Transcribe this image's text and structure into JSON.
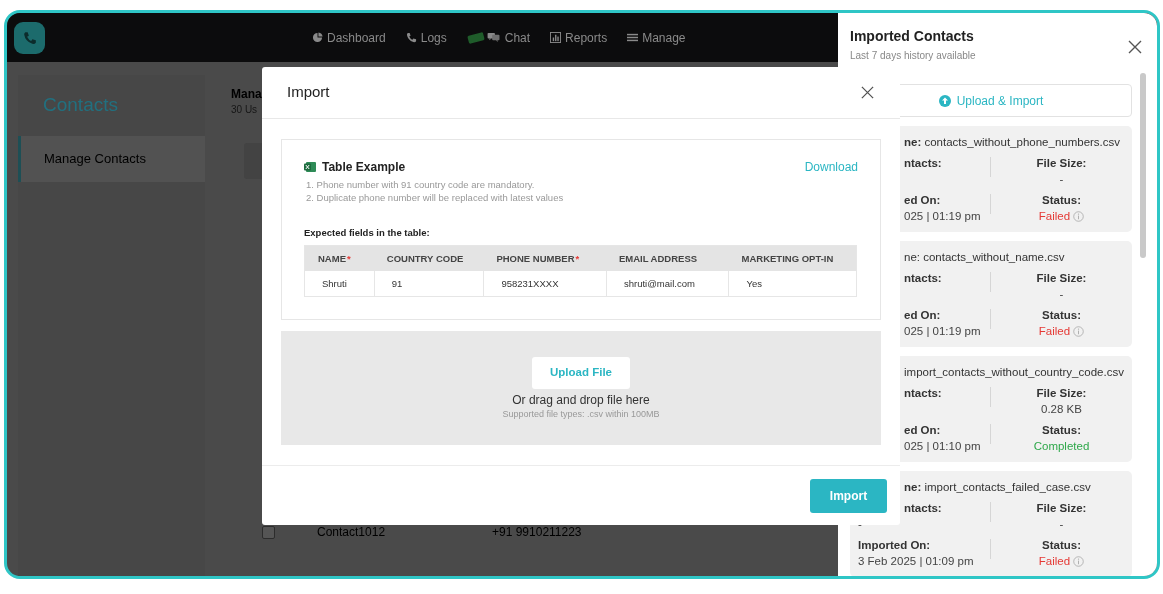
{
  "nav": {
    "items": [
      {
        "label": "Dashboard",
        "kind": "pie",
        "badge": false
      },
      {
        "label": "Logs",
        "kind": "phone",
        "badge": false
      },
      {
        "label": "Chat",
        "kind": "chat",
        "badge": true
      },
      {
        "label": "Reports",
        "kind": "bars",
        "badge": false
      },
      {
        "label": "Manage",
        "kind": "list",
        "badge": false
      }
    ]
  },
  "sidebar": {
    "title": "Contacts",
    "items": [
      {
        "label": "Manage Contacts",
        "selected": true
      }
    ]
  },
  "main": {
    "title": "Mana",
    "subtitle": "30 Us",
    "row": {
      "checked": false,
      "name": "Contact1012",
      "phone": "+91 9910211223"
    }
  },
  "modal": {
    "title": "Import",
    "example": {
      "title": "Table Example",
      "download": "Download",
      "notes": [
        "1. Phone number with 91 country code are mandatory.",
        "2. Duplicate phone number will be replaced with latest values"
      ],
      "fields_title": "Expected fields in the table:",
      "columns": [
        {
          "label": "NAME",
          "mark": "*"
        },
        {
          "label": "COUNTRY CODE"
        },
        {
          "label": "PHONE NUMBER",
          "mark": "*"
        },
        {
          "label": "EMAIL ADDRESS"
        },
        {
          "label": "MARKETING OPT-IN"
        }
      ],
      "row": [
        "Shruti",
        "91",
        "958231XXXX",
        "shruti@mail.com",
        "Yes"
      ]
    },
    "upload": {
      "button": "Upload File",
      "hint": "Or drag and drop file here",
      "note": "Supported file types: .csv within 100MB"
    },
    "import_button": "Import"
  },
  "drawer": {
    "title": "Imported Contacts",
    "subtitle": "Last 7 days history available",
    "upload_button": "Upload & Import",
    "cards": [
      {
        "name": {
          "text": "**ne:** contacts_without_phone_numbers.csv",
          "cut": true
        },
        "blocks": [
          {
            "left": [
              {
                "text": "ntacts:",
                "kind": "label",
                "cut": true
              }
            ],
            "right": [
              {
                "text": "File Size:",
                "kind": "label"
              },
              {
                "text": "-",
                "kind": "value"
              }
            ]
          },
          {
            "left": [
              {
                "text": "ed On:",
                "kind": "label",
                "cut": true
              },
              {
                "text": "025 | 01:19 pm",
                "kind": "value",
                "cut": true
              }
            ],
            "right": [
              {
                "text": "Status:",
                "kind": "label"
              },
              {
                "text": "Failed",
                "kind": "failed"
              }
            ]
          }
        ]
      },
      {
        "name": {
          "text": "ne: contacts_without_name.csv",
          "cut": true
        },
        "blocks": [
          {
            "left": [
              {
                "text": "ntacts:",
                "kind": "label",
                "cut": true
              }
            ],
            "right": [
              {
                "text": "File Size:",
                "kind": "label"
              },
              {
                "text": "-",
                "kind": "value"
              }
            ]
          },
          {
            "left": [
              {
                "text": "ed On:",
                "kind": "label",
                "cut": true
              },
              {
                "text": "025 | 01:19 pm",
                "kind": "value",
                "cut": true
              }
            ],
            "right": [
              {
                "text": "Status:",
                "kind": "label"
              },
              {
                "text": "Failed",
                "kind": "failed"
              }
            ]
          }
        ]
      },
      {
        "name": {
          "text": "import_contacts_without_country_code.csv",
          "cut": true
        },
        "blocks": [
          {
            "left": [
              {
                "text": "ntacts:",
                "kind": "label",
                "cut": true
              }
            ],
            "right": [
              {
                "text": "File Size:",
                "kind": "label"
              },
              {
                "text": "0.28 KB",
                "kind": "value"
              }
            ]
          },
          {
            "left": [
              {
                "text": "ed On:",
                "kind": "label",
                "cut": true
              },
              {
                "text": "025 | 01:10 pm",
                "kind": "value",
                "cut": true
              }
            ],
            "right": [
              {
                "text": "Status:",
                "kind": "label"
              },
              {
                "text": "Completed",
                "kind": "completed"
              }
            ]
          }
        ]
      },
      {
        "name": {
          "text": "**ne:** import_contacts_failed_case.csv",
          "cut": true
        },
        "blocks": [
          {
            "left": [
              {
                "text": "ntacts:",
                "kind": "label",
                "cut": true
              },
              {
                "text": "-",
                "kind": "value",
                "cut": false
              }
            ],
            "right": [
              {
                "text": "File Size:",
                "kind": "label"
              },
              {
                "text": "-",
                "kind": "value"
              }
            ]
          },
          {
            "left": [
              {
                "text": "Imported On:",
                "kind": "label",
                "cut": false
              },
              {
                "text": "3 Feb 2025 | 01:09 pm",
                "kind": "value",
                "cut": false
              }
            ],
            "right": [
              {
                "text": "Status:",
                "kind": "label"
              },
              {
                "text": "Failed",
                "kind": "failed"
              }
            ]
          }
        ]
      }
    ]
  }
}
